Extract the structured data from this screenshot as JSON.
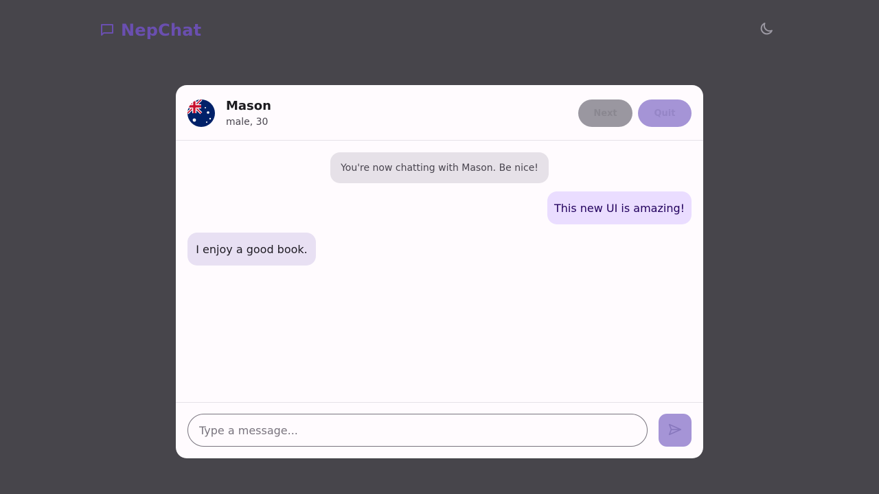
{
  "app": {
    "name": "NepChat",
    "logo_icon": "chat-bubble-icon",
    "theme_toggle_icon": "moon-icon",
    "brand_color": "#6a4fb0"
  },
  "peer": {
    "name": "Mason",
    "meta": "male, 30",
    "avatar_icon": "australia-flag-icon"
  },
  "header": {
    "next_label": "Next",
    "quit_label": "Quit"
  },
  "messages": {
    "system": "You're now chatting with Mason. Be nice!",
    "items": [
      {
        "from": "self",
        "text": "This new UI is amazing!"
      },
      {
        "from": "peer",
        "text": "I enjoy a good book."
      }
    ]
  },
  "composer": {
    "placeholder": "Type a message...",
    "value": "",
    "send_icon": "send-icon"
  },
  "colors": {
    "background": "#47454b",
    "card": "#fffbfe",
    "self_bubble": "#eaddff",
    "peer_bubble": "#e8e0f3",
    "system_bubble": "#e6e1e8",
    "accent": "#a594d6"
  }
}
